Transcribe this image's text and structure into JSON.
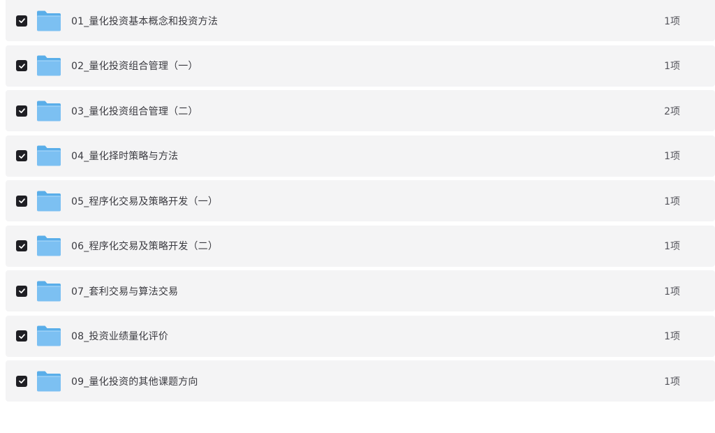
{
  "colors": {
    "row_background": "#f4f4f5",
    "checkbox": "#1f1f24",
    "folder_front": "#7cc0f2",
    "folder_back": "#5aaee9",
    "text": "#3a3a40"
  },
  "icons": {
    "checkbox": "checkmark-icon",
    "item": "folder-icon"
  },
  "folders": [
    {
      "name": "01_量化投资基本概念和投资方法",
      "count": "1项",
      "checked": true
    },
    {
      "name": "02_量化投资组合管理（一）",
      "count": "1项",
      "checked": true
    },
    {
      "name": "03_量化投资组合管理（二）",
      "count": "2项",
      "checked": true
    },
    {
      "name": "04_量化择时策略与方法",
      "count": "1项",
      "checked": true
    },
    {
      "name": "05_程序化交易及策略开发（一）",
      "count": "1项",
      "checked": true
    },
    {
      "name": "06_程序化交易及策略开发（二）",
      "count": "1项",
      "checked": true
    },
    {
      "name": "07_套利交易与算法交易",
      "count": "1项",
      "checked": true
    },
    {
      "name": "08_投资业绩量化评价",
      "count": "1项",
      "checked": true
    },
    {
      "name": "09_量化投资的其他课题方向",
      "count": "1项",
      "checked": true
    }
  ]
}
